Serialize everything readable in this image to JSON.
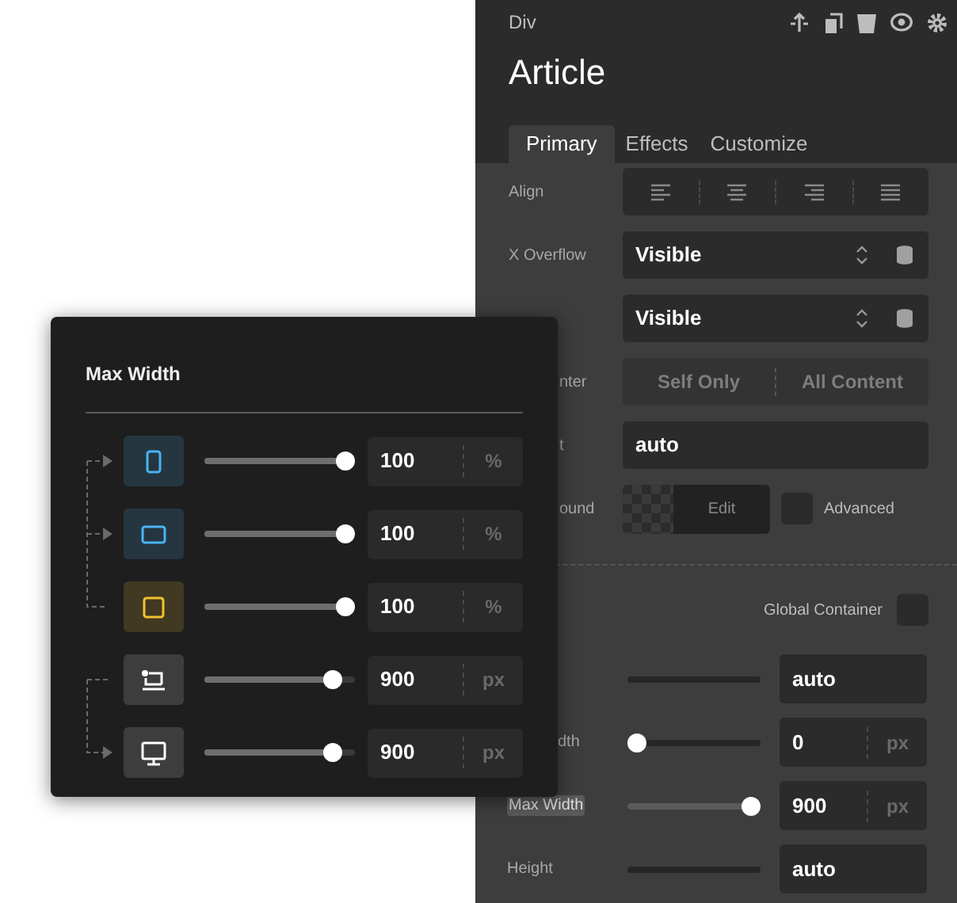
{
  "panel": {
    "element_type": "Div",
    "title": "Article"
  },
  "tabs": [
    {
      "label": "Primary",
      "selected": true
    },
    {
      "label": "Effects",
      "selected": false
    },
    {
      "label": "Customize",
      "selected": false
    }
  ],
  "settings": [
    {
      "kind": "align",
      "label": "Align"
    },
    {
      "kind": "select",
      "label": "X Overflow",
      "value": "Visible"
    },
    {
      "kind": "select",
      "value": "Visible"
    },
    {
      "kind": "segments",
      "label": "nter",
      "cut": true,
      "options": [
        "Self Only",
        "All Content"
      ]
    },
    {
      "kind": "text",
      "label": "t",
      "cut": true,
      "value": "auto"
    },
    {
      "kind": "background",
      "label": "ound",
      "cut": true,
      "button": "Edit",
      "checkbox_label": "Advanced",
      "checked": false
    }
  ],
  "global_container": {
    "label": "Global Container",
    "checked": false
  },
  "sizes": [
    {
      "kind": "track",
      "value": "auto"
    },
    {
      "kind": "slider",
      "label": "dth",
      "cut": true,
      "level": 0,
      "value": "0",
      "unit": "px"
    },
    {
      "kind": "slider",
      "label": "Max Width",
      "highlighted": true,
      "level": 1,
      "value": "900",
      "unit": "px"
    },
    {
      "kind": "track",
      "label": "Height",
      "value": "auto"
    }
  ],
  "popup": {
    "title": "Max Width",
    "rows": [
      {
        "kind": "phone",
        "color": "#4ab3f4",
        "level": 1,
        "value": "100",
        "unit": "%"
      },
      {
        "kind": "tablet",
        "color": "#4ab3f4",
        "level": 1,
        "value": "100",
        "unit": "%"
      },
      {
        "kind": "square",
        "color": "#f2c12e",
        "level": 1,
        "value": "100",
        "unit": "%"
      },
      {
        "kind": "laptop",
        "level": 0.9,
        "value": "900",
        "unit": "px"
      },
      {
        "kind": "desktop",
        "level": 0.9,
        "value": "900",
        "unit": "px"
      }
    ]
  }
}
